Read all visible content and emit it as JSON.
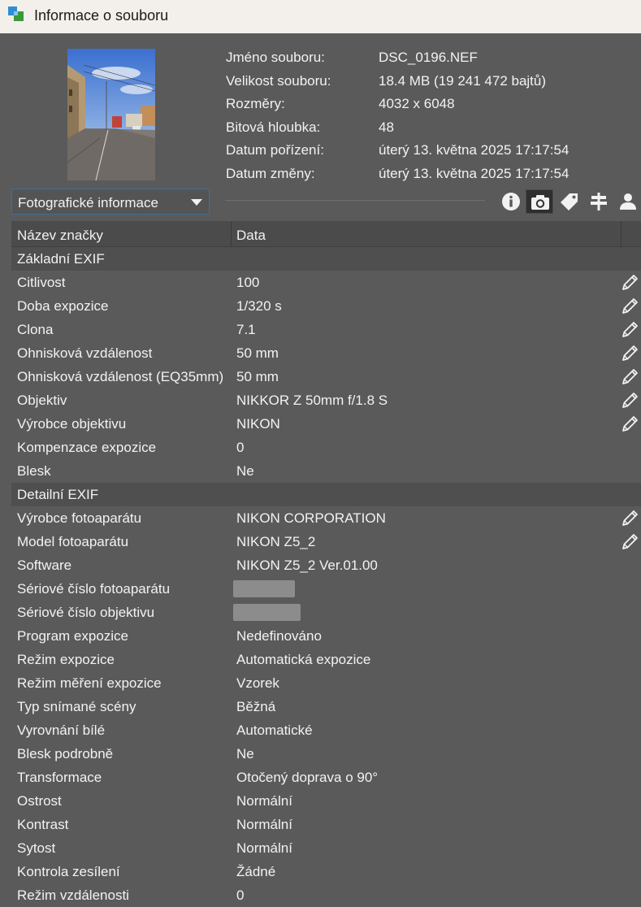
{
  "window": {
    "title": "Informace o souboru"
  },
  "file_info": [
    {
      "label": "Jméno souboru:",
      "value": "DSC_0196.NEF"
    },
    {
      "label": "Velikost souboru:",
      "value": "18.4 MB (19 241 472 bajtů)"
    },
    {
      "label": "Rozměry:",
      "value": "4032 x 6048"
    },
    {
      "label": "Bitová hloubka:",
      "value": "48"
    },
    {
      "label": "Datum pořízení:",
      "value": "úterý 13. května 2025 17:17:54"
    },
    {
      "label": "Datum změny:",
      "value": "úterý 13. května 2025 17:17:54"
    }
  ],
  "dropdown": {
    "selected": "Fotografické informace"
  },
  "toolbar": {
    "icons": [
      "info-icon",
      "camera-icon",
      "tag-icon",
      "signpost-icon",
      "user-icon"
    ],
    "active": "camera-icon"
  },
  "table": {
    "headers": {
      "name": "Název značky",
      "data": "Data"
    },
    "rows": [
      {
        "group": true,
        "name": "Základní EXIF",
        "value": ""
      },
      {
        "name": "Citlivost",
        "value": "100",
        "editable": true
      },
      {
        "name": "Doba expozice",
        "value": "1/320 s",
        "editable": true
      },
      {
        "name": "Clona",
        "value": "7.1",
        "editable": true
      },
      {
        "name": "Ohnisková vzdálenost",
        "value": "50 mm",
        "editable": true
      },
      {
        "name": "Ohnisková vzdálenost (EQ35mm)",
        "value": "50 mm",
        "editable": true
      },
      {
        "name": "Objektiv",
        "value": "NIKKOR Z 50mm f/1.8 S",
        "editable": true
      },
      {
        "name": "Výrobce objektivu",
        "value": "NIKON",
        "editable": true
      },
      {
        "name": "Kompenzace expozice",
        "value": "0"
      },
      {
        "name": "Blesk",
        "value": "Ne"
      },
      {
        "group": true,
        "name": "Detailní EXIF",
        "value": ""
      },
      {
        "name": "Výrobce fotoaparátu",
        "value": "NIKON CORPORATION",
        "editable": true
      },
      {
        "name": "Model fotoaparátu",
        "value": "NIKON Z5_2",
        "editable": true
      },
      {
        "name": "Software",
        "value": "NIKON Z5_2 Ver.01.00"
      },
      {
        "name": "Sériové číslo fotoaparátu",
        "value": "",
        "redacted": true
      },
      {
        "name": "Sériové číslo objektivu",
        "value": "",
        "redacted": true
      },
      {
        "name": "Program expozice",
        "value": "Nedefinováno"
      },
      {
        "name": "Režim expozice",
        "value": "Automatická expozice"
      },
      {
        "name": "Režim měření expozice",
        "value": "Vzorek"
      },
      {
        "name": "Typ snímané scény",
        "value": "Běžná"
      },
      {
        "name": "Vyrovnání bílé",
        "value": "Automatické"
      },
      {
        "name": "Blesk podrobně",
        "value": "Ne"
      },
      {
        "name": "Transformace",
        "value": "Otočený doprava o 90°"
      },
      {
        "name": "Ostrost",
        "value": "Normální"
      },
      {
        "name": "Kontrast",
        "value": "Normální"
      },
      {
        "name": "Sytost",
        "value": "Normální"
      },
      {
        "name": "Kontrola zesílení",
        "value": "Žádné"
      },
      {
        "name": "Režim vzdálenosti",
        "value": "0"
      }
    ]
  }
}
